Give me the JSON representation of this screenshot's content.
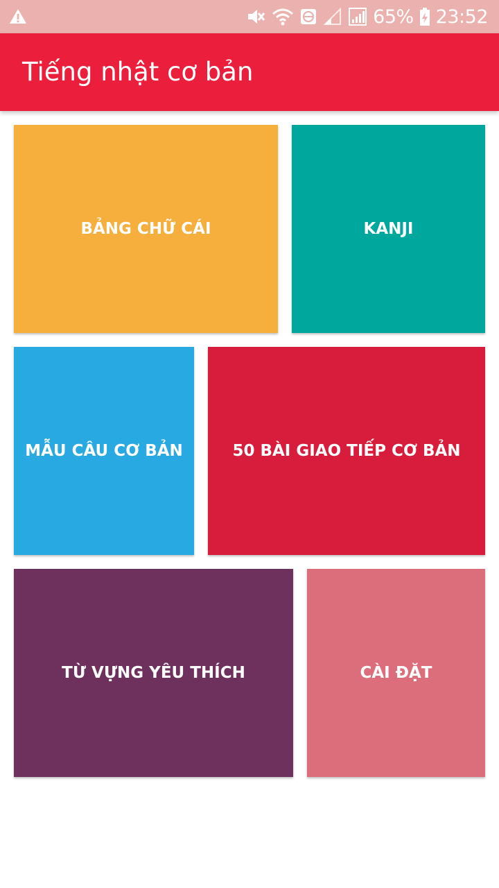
{
  "status_bar": {
    "battery": "65%",
    "time": "23:52",
    "icons": [
      "warning-icon",
      "mute-icon",
      "wifi-icon",
      "signal-icon",
      "battery-charging-icon"
    ]
  },
  "app_bar": {
    "title": "Tiếng nhật cơ bản"
  },
  "tiles": {
    "alphabet": {
      "label": "BẢNG CHỮ CÁI",
      "color": "#f6ae3c"
    },
    "kanji": {
      "label": "KANJI",
      "color": "#00a79d"
    },
    "sentences": {
      "label": "MẪU CÂU CƠ BẢN",
      "color": "#29a9e1"
    },
    "conversations": {
      "label": "50 BÀI GIAO TIẾP CƠ BẢN",
      "color": "#d81d3c"
    },
    "favorites": {
      "label": "TỪ VỰNG YÊU THÍCH",
      "color": "#6e305c"
    },
    "settings": {
      "label": "CÀI ĐẶT",
      "color": "#dc6e7c"
    }
  }
}
